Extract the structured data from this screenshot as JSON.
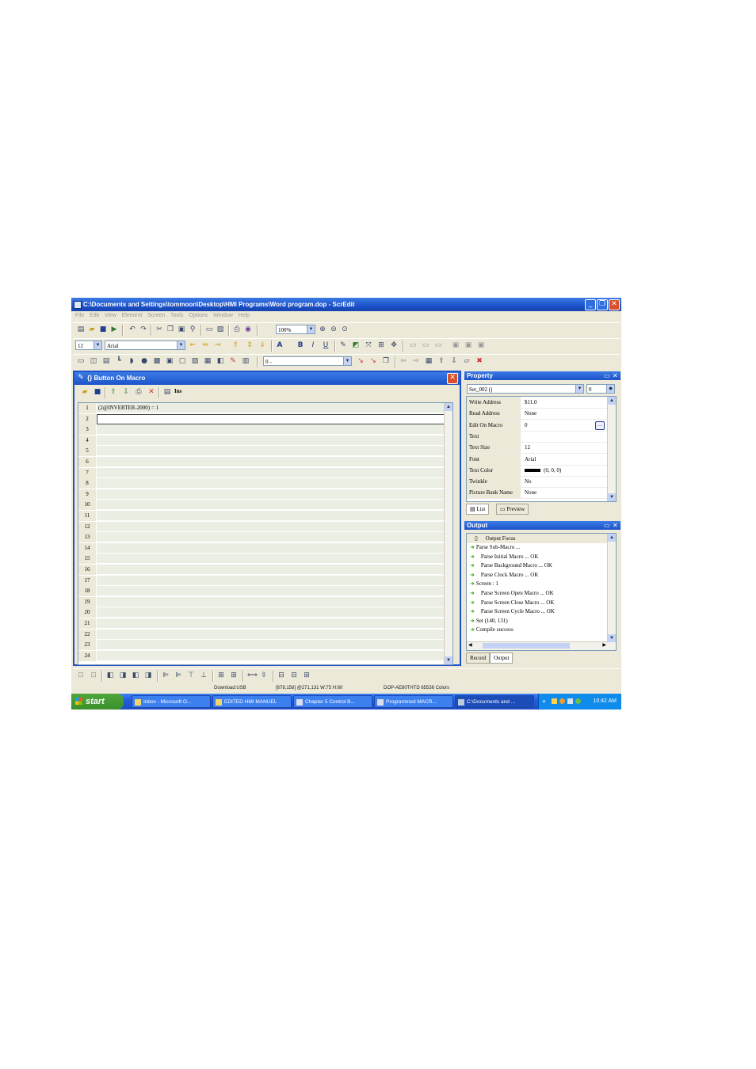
{
  "window": {
    "title": "C:\\Documents and Settings\\tommoon\\Desktop\\HMI Programs\\Word program.dop - ScrEdit",
    "buttons": {
      "minimize": "_",
      "restore": "❐",
      "close": "✕"
    }
  },
  "menu": [
    "File",
    "Edit",
    "View",
    "Element",
    "Screen",
    "Tools",
    "Options",
    "Window",
    "Help"
  ],
  "toolbar": {
    "zoom": "100%",
    "font_size": "12",
    "font_name": "Arial",
    "state_value": "0 -"
  },
  "macro_dialog": {
    "title": "{} Button On Macro",
    "ins_label": "Ins",
    "lines": [
      {
        "num": "1",
        "text": "(2@INVERTER-2000) = 1"
      },
      {
        "num": "2",
        "text": ""
      },
      {
        "num": "3",
        "text": ""
      },
      {
        "num": "4",
        "text": ""
      },
      {
        "num": "5",
        "text": ""
      },
      {
        "num": "6",
        "text": ""
      },
      {
        "num": "7",
        "text": ""
      },
      {
        "num": "8",
        "text": ""
      },
      {
        "num": "9",
        "text": ""
      },
      {
        "num": "10",
        "text": ""
      },
      {
        "num": "11",
        "text": ""
      },
      {
        "num": "12",
        "text": ""
      },
      {
        "num": "13",
        "text": ""
      },
      {
        "num": "14",
        "text": ""
      },
      {
        "num": "15",
        "text": ""
      },
      {
        "num": "16",
        "text": ""
      },
      {
        "num": "17",
        "text": ""
      },
      {
        "num": "18",
        "text": ""
      },
      {
        "num": "19",
        "text": ""
      },
      {
        "num": "20",
        "text": ""
      },
      {
        "num": "21",
        "text": ""
      },
      {
        "num": "22",
        "text": ""
      },
      {
        "num": "23",
        "text": ""
      },
      {
        "num": "24",
        "text": ""
      }
    ]
  },
  "property": {
    "title": "Property",
    "object_select": "Set_002 ()",
    "state_select": "0",
    "rows": [
      {
        "key": "Write Address",
        "value": "$11.0"
      },
      {
        "key": "Read Address",
        "value": "None"
      },
      {
        "key": "Edit On Macro",
        "value": "0"
      },
      {
        "key": "Text",
        "value": ""
      },
      {
        "key": "Text Size",
        "value": "12"
      },
      {
        "key": "Font",
        "value": "Arial"
      },
      {
        "key": "Text Color",
        "value": "(0, 0, 0)"
      },
      {
        "key": "Twinkle",
        "value": "No"
      },
      {
        "key": "Picture Bank Name",
        "value": "None"
      }
    ],
    "tabs": [
      "List",
      "Preview"
    ]
  },
  "output": {
    "title": "Output",
    "focus_label": "Output Focus",
    "lines": [
      {
        "text": "Parse Sub-Macro ...",
        "indent": false
      },
      {
        "text": "Parse Initial Macro ... OK",
        "indent": true
      },
      {
        "text": "Parse Background Macro ... OK",
        "indent": true
      },
      {
        "text": "Parse Clock Macro ... OK",
        "indent": true
      },
      {
        "text": "Screen : 1",
        "indent": false
      },
      {
        "text": "Parse Screen Open Macro ... OK",
        "indent": true
      },
      {
        "text": "Parse Screen Close Macro ... OK",
        "indent": true
      },
      {
        "text": "Parse Screen Cycle Macro ... OK",
        "indent": true
      },
      {
        "text": "Set (140, 131)",
        "indent": false
      },
      {
        "text": "Compile success",
        "indent": false
      }
    ],
    "tabs": [
      "Record",
      "Output"
    ]
  },
  "status": {
    "download": "Download:USB",
    "coords": "[678,158] @271,131 W:75 H:60",
    "model": "DOP-AE80THTD 65536 Colors"
  },
  "taskbar": {
    "start": "start",
    "items": [
      "Inbox - Microsoft O...",
      "EDITED HMI MANUEL",
      "Chapter 5 Control B...",
      "Programmed MACR...",
      "C:\\Documents and ..."
    ],
    "clock": "10:42 AM"
  }
}
